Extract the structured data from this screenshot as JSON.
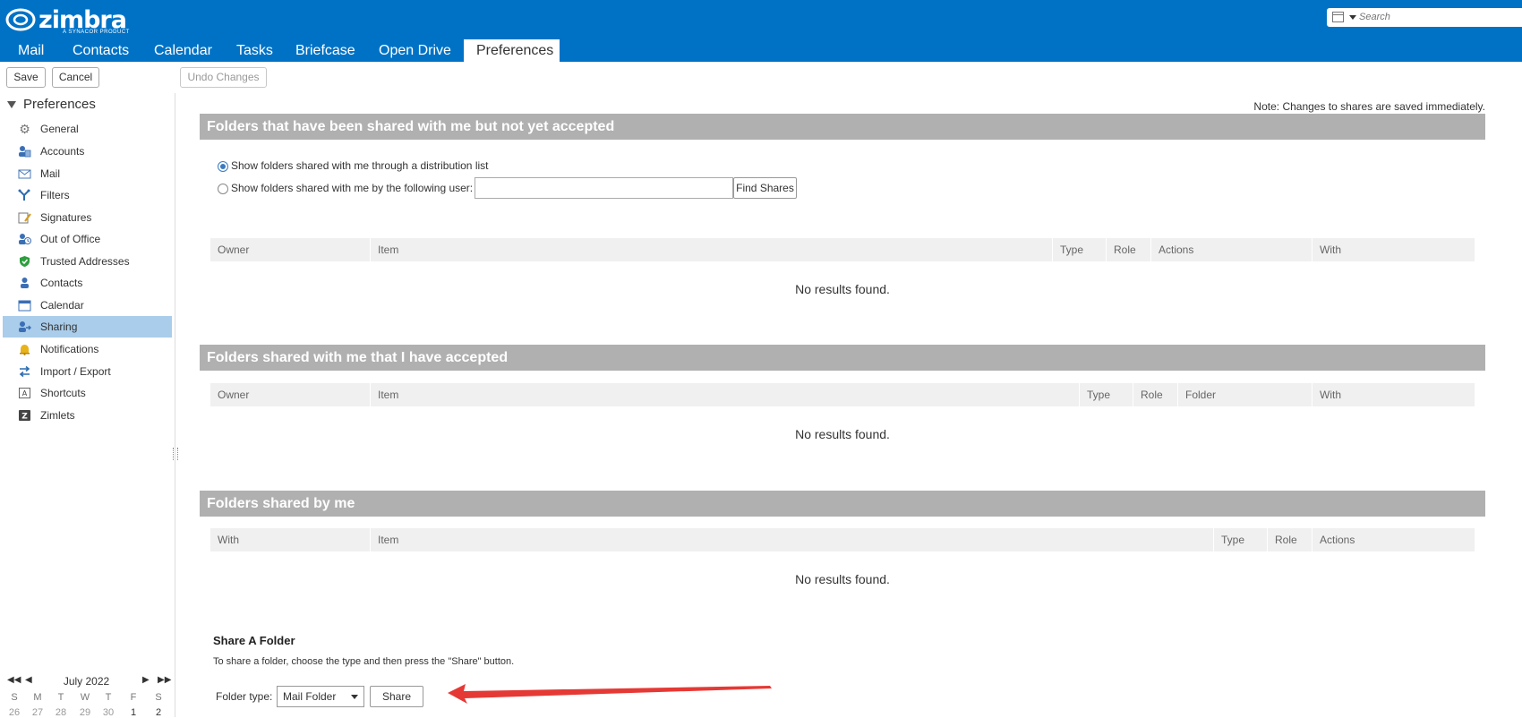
{
  "app": {
    "logo_text": "zimbra",
    "logo_subtext": "A SYNACOR PRODUCT"
  },
  "search": {
    "placeholder": "Search"
  },
  "tabs": [
    {
      "label": "Mail"
    },
    {
      "label": "Contacts"
    },
    {
      "label": "Calendar"
    },
    {
      "label": "Tasks"
    },
    {
      "label": "Briefcase"
    },
    {
      "label": "Open Drive"
    },
    {
      "label": "Preferences",
      "active": true
    }
  ],
  "toolbar": {
    "save_label": "Save",
    "cancel_label": "Cancel",
    "undo_label": "Undo Changes"
  },
  "sidebar": {
    "title": "Preferences",
    "items": [
      {
        "label": "General",
        "icon": "gear-icon"
      },
      {
        "label": "Accounts",
        "icon": "accounts-icon"
      },
      {
        "label": "Mail",
        "icon": "envelope-icon"
      },
      {
        "label": "Filters",
        "icon": "filter-icon"
      },
      {
        "label": "Signatures",
        "icon": "signature-icon"
      },
      {
        "label": "Out of Office",
        "icon": "out-of-office-icon"
      },
      {
        "label": "Trusted Addresses",
        "icon": "shield-icon"
      },
      {
        "label": "Contacts",
        "icon": "contact-icon"
      },
      {
        "label": "Calendar",
        "icon": "calendar-icon"
      },
      {
        "label": "Sharing",
        "icon": "sharing-icon",
        "active": true
      },
      {
        "label": "Notifications",
        "icon": "bell-icon"
      },
      {
        "label": "Import / Export",
        "icon": "import-export-icon"
      },
      {
        "label": "Shortcuts",
        "icon": "shortcut-icon"
      },
      {
        "label": "Zimlets",
        "icon": "zimlet-icon"
      }
    ]
  },
  "mini_calendar": {
    "month": "July 2022",
    "days": [
      "S",
      "M",
      "T",
      "W",
      "T",
      "F",
      "S"
    ],
    "dates": [
      "26",
      "27",
      "28",
      "29",
      "30",
      "1",
      "2"
    ]
  },
  "main": {
    "note": "Note: Changes to shares are saved immediately.",
    "pending": {
      "title": "Folders that have been shared with me but not yet accepted",
      "radio_dl": "Show folders shared with me through a distribution list",
      "radio_user": "Show folders shared with me by the following user:",
      "find_label": "Find Shares",
      "columns": [
        "Owner",
        "Item",
        "Type",
        "Role",
        "Actions",
        "With"
      ],
      "empty": "No results found."
    },
    "accepted": {
      "title": "Folders shared with me that I have accepted",
      "columns": [
        "Owner",
        "Item",
        "Type",
        "Role",
        "Folder",
        "With"
      ],
      "empty": "No results found."
    },
    "by_me": {
      "title": "Folders shared by me",
      "columns": [
        "With",
        "Item",
        "Type",
        "Role",
        "Actions"
      ],
      "empty": "No results found."
    },
    "share_folder": {
      "title": "Share A Folder",
      "description": "To share a folder, choose the type and then press the \"Share\" button.",
      "type_label": "Folder type:",
      "type_value": "Mail Folder",
      "share_label": "Share"
    }
  },
  "colors": {
    "header": "#0072c6",
    "section_bar": "#b0b0b0",
    "sidebar_active": "#a9cdea",
    "arrow": "#e53935"
  }
}
